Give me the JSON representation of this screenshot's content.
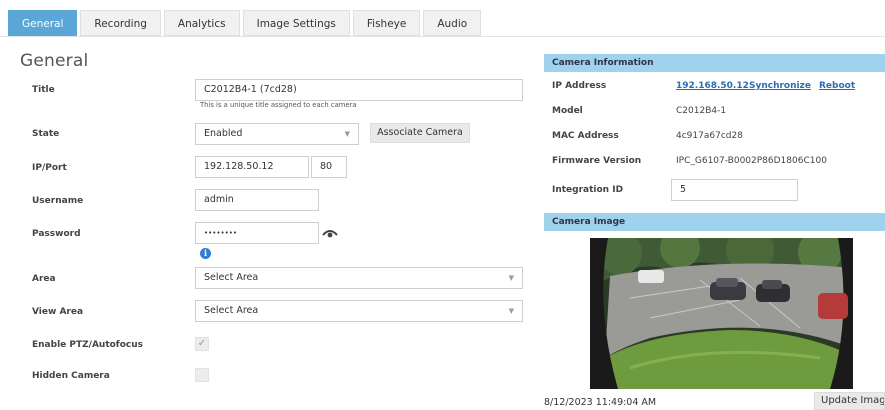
{
  "tabs": [
    "General",
    "Recording",
    "Analytics",
    "Image Settings",
    "Fisheye",
    "Audio"
  ],
  "active_tab": "General",
  "section_title": "General",
  "form": {
    "title_label": "Title",
    "title_value": "C2012B4-1 (7cd28)",
    "title_hint": "This is a unique title assigned to each camera",
    "state_label": "State",
    "state_value": "Enabled",
    "associate_button": "Associate Camera",
    "ipport_label": "IP/Port",
    "ip_value": "192.128.50.12",
    "port_value": "80",
    "username_label": "Username",
    "username_value": "admin",
    "password_label": "Password",
    "password_value": "••••••••",
    "info_glyph": "i",
    "area_label": "Area",
    "area_value": "Select Area",
    "view_area_label": "View Area",
    "view_area_value": "Select Area",
    "ptz_label": "Enable PTZ/Autofocus",
    "ptz_checked": true,
    "hidden_label": "Hidden Camera",
    "hidden_checked": false,
    "checkmark_glyph": "✓",
    "caret_glyph": "▼"
  },
  "camera_info": {
    "header": "Camera Information",
    "ip_label": "IP Address",
    "ip_value": "192.168.50.12",
    "synchronize_link": "Synchronize",
    "reboot_link": "Reboot",
    "model_label": "Model",
    "model_value": "C2012B4-1",
    "mac_label": "MAC Address",
    "mac_value": "4c917a67cd28",
    "firmware_label": "Firmware Version",
    "firmware_value": "IPC_G6107-B0002P86D1806C100",
    "integration_label": "Integration ID",
    "integration_value": "5"
  },
  "camera_image": {
    "header": "Camera Image",
    "timestamp": "8/12/2023 11:49:04 AM",
    "update_button": "Update Image"
  },
  "colors": {
    "tab_active": "#5aa6d6",
    "panel_header": "#9fd2ec",
    "link": "#2a6db5",
    "info_icon": "#2f7fd0"
  },
  "icons": [
    "eye-icon",
    "info-icon",
    "dropdown-caret-icon",
    "checkmark-icon"
  ]
}
